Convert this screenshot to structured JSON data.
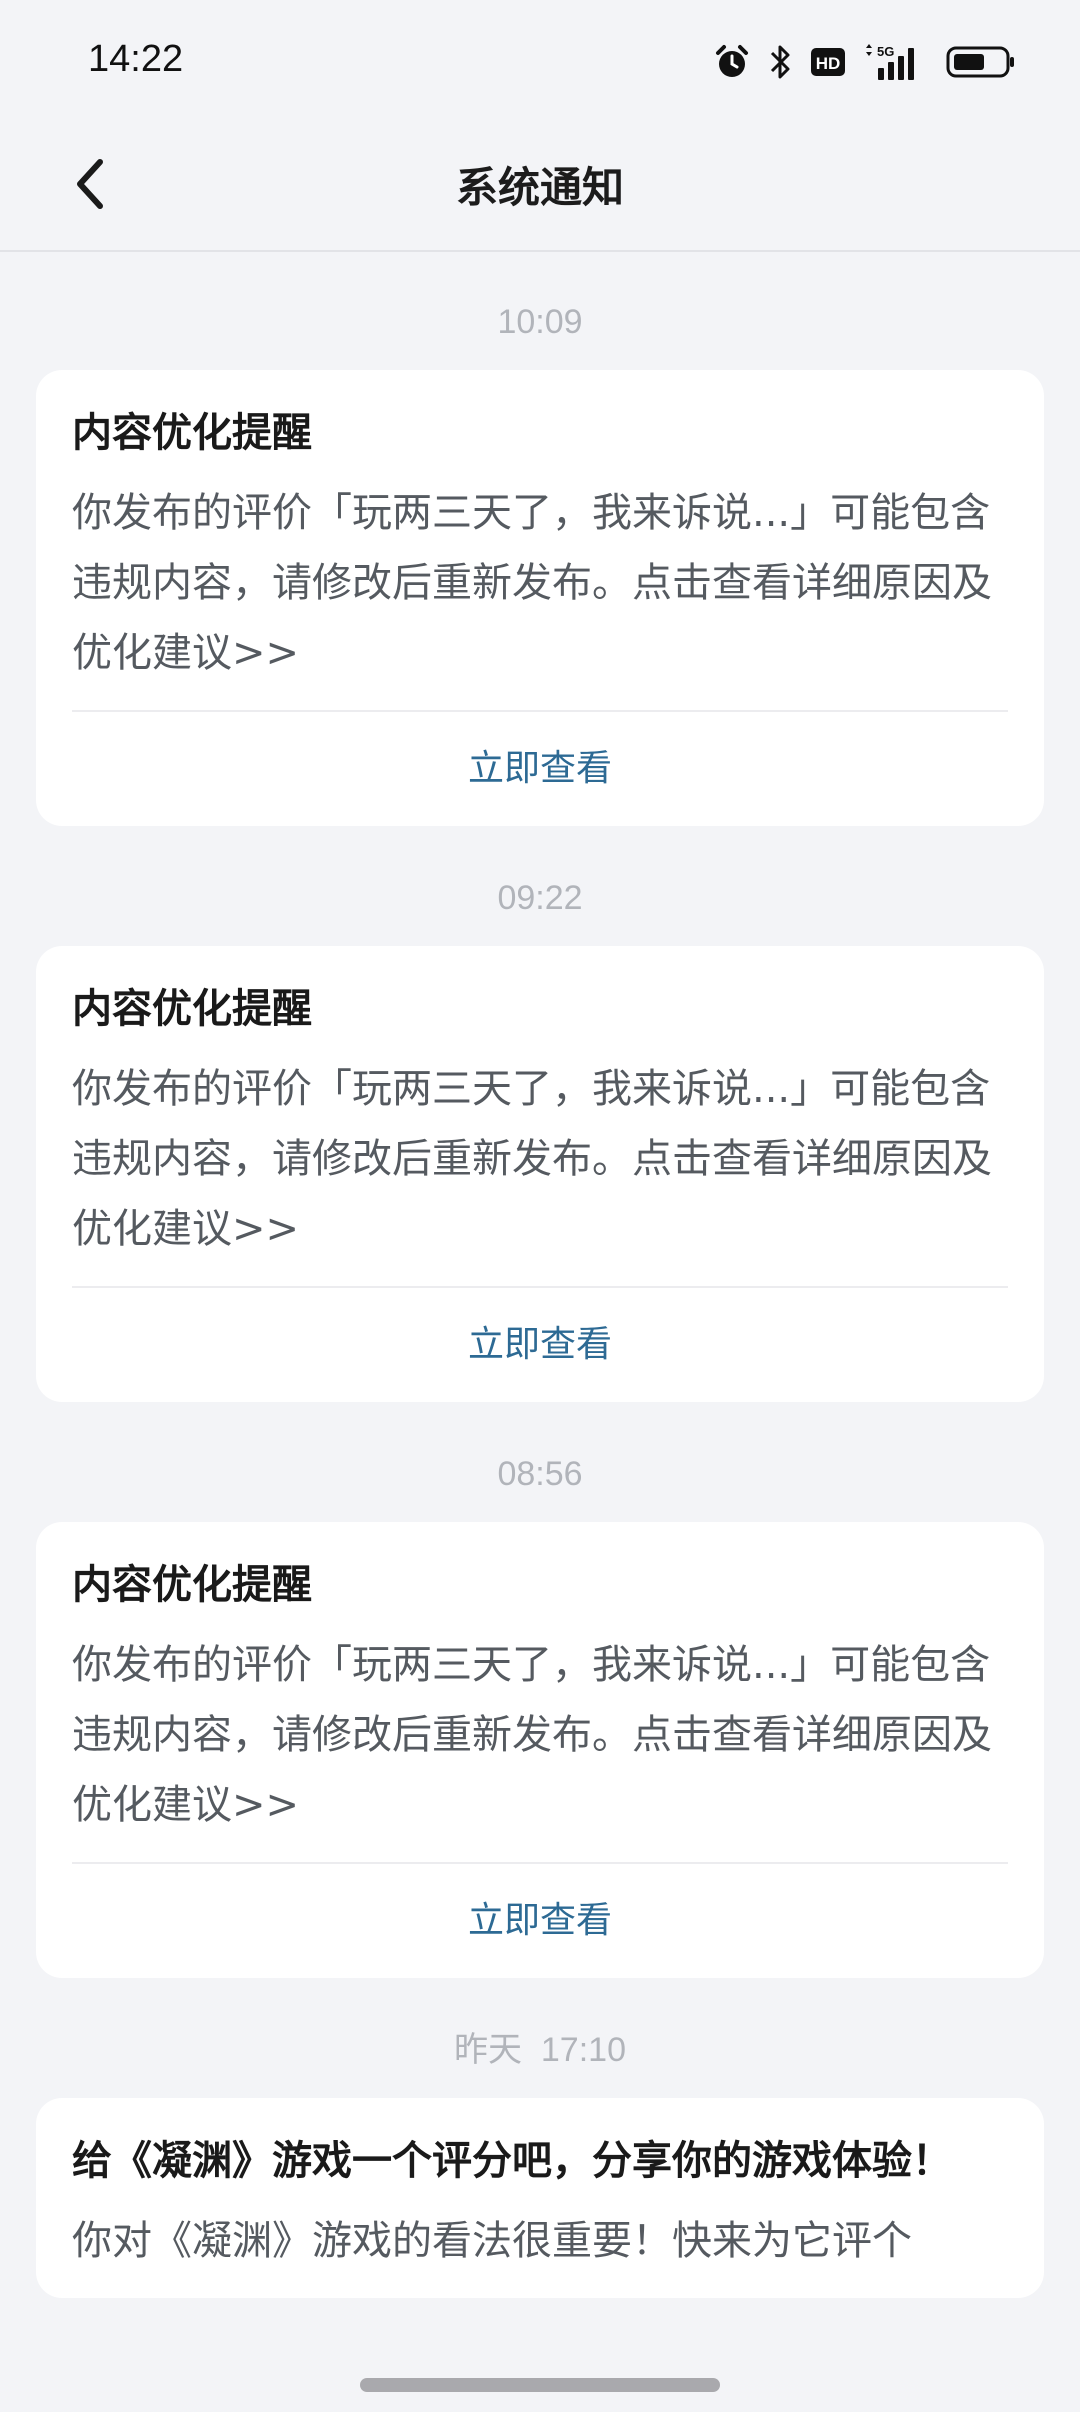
{
  "status_bar": {
    "time": "14:22",
    "icons": [
      "alarm-icon",
      "bluetooth-icon",
      "hd-icon",
      "5g-signal-icon",
      "battery-icon"
    ],
    "network": "5G",
    "hd": "HD"
  },
  "header": {
    "title": "系统通知",
    "back_icon": "chevron-left-icon"
  },
  "notifications": [
    {
      "time": "10:09",
      "title": "内容优化提醒",
      "body": "你发布的评价「玩两三天了，我来诉说...」可能包含违规内容，请修改后重新发布。点击查看详细原因及优化建议>>",
      "action": "立即查看"
    },
    {
      "time": "09:22",
      "title": "内容优化提醒",
      "body": "你发布的评价「玩两三天了，我来诉说...」可能包含违规内容，请修改后重新发布。点击查看详细原因及优化建议>>",
      "action": "立即查看"
    },
    {
      "time": "08:56",
      "title": "内容优化提醒",
      "body": "你发布的评价「玩两三天了，我来诉说...」可能包含违规内容，请修改后重新发布。点击查看详细原因及优化建议>>",
      "action": "立即查看"
    },
    {
      "time": "昨天  17:10",
      "title": "给《凝渊》游戏一个评分吧，分享你的游戏体验！",
      "body": "你对《凝渊》游戏的看法很重要！快来为它评个"
    }
  ],
  "colors": {
    "background": "#f3f4f7",
    "card": "#ffffff",
    "action_link": "#2d6a94",
    "time_label": "#b1b4ba"
  }
}
